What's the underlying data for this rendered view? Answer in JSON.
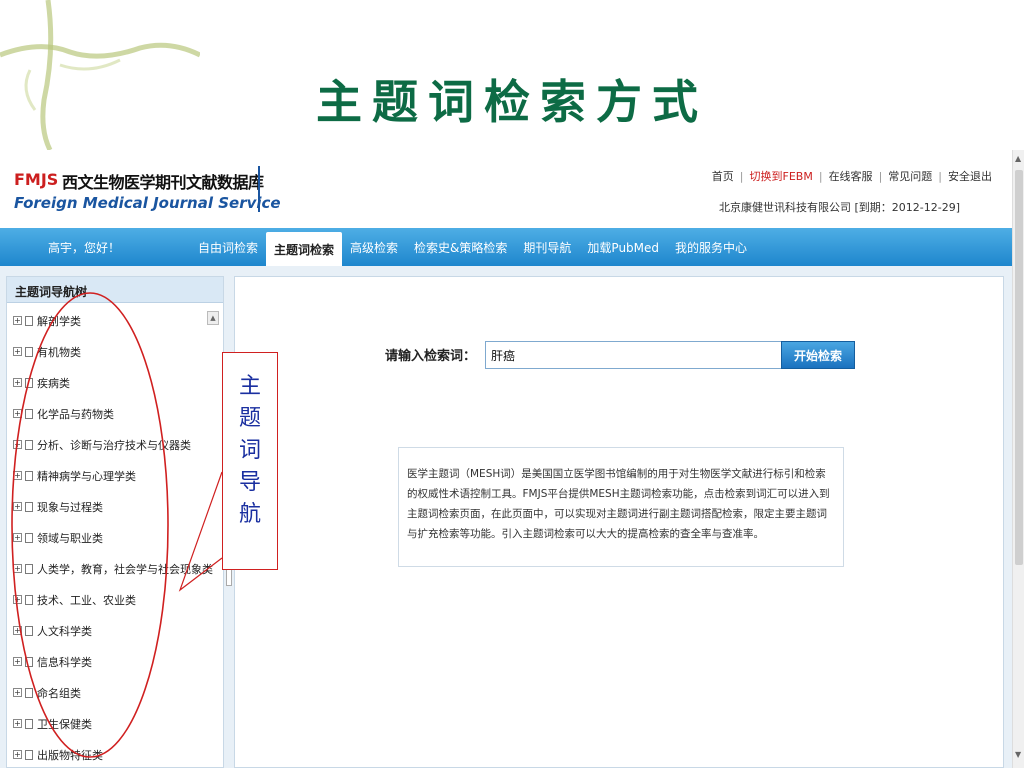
{
  "slide": {
    "title": "主题词检索方式"
  },
  "header": {
    "logo_abbr": "FMJS",
    "logo_cn": "西文生物医学期刊文献数据库",
    "logo_en": "Foreign Medical Journal Service",
    "top_links": [
      {
        "label": "首页",
        "color": "#333333"
      },
      {
        "label": "切换到FEBM",
        "color": "#cc1f1f"
      },
      {
        "label": "在线客服",
        "color": "#333333"
      },
      {
        "label": "常见问题",
        "color": "#333333"
      },
      {
        "label": "安全退出",
        "color": "#333333"
      }
    ],
    "company": "北京康健世讯科技有限公司 [到期：2012-12-29]"
  },
  "nav": {
    "greeting": "高宇，您好！",
    "items": [
      {
        "label": "自由词检索",
        "active": false
      },
      {
        "label": "主题词检索",
        "active": true
      },
      {
        "label": "高级检索",
        "active": false
      },
      {
        "label": "检索史&策略检索",
        "active": false
      },
      {
        "label": "期刊导航",
        "active": false
      },
      {
        "label": "加载PubMed",
        "active": false
      },
      {
        "label": "我的服务中心",
        "active": false
      }
    ]
  },
  "sidebar": {
    "title": "主题词导航树",
    "items": [
      "解剖学类",
      "有机物类",
      "疾病类",
      "化学品与药物类",
      "分析、诊断与治疗技术与仪器类",
      "精神病学与心理学类",
      "现象与过程类",
      "领域与职业类",
      "人类学，教育，社会学与社会现象类",
      "技术、工业、农业类",
      "人文科学类",
      "信息科学类",
      "命名组类",
      "卫生保健类",
      "出版物特征类"
    ]
  },
  "search": {
    "label": "请输入检索词：",
    "value": "肝癌",
    "button": "开始检索"
  },
  "info": {
    "text": "医学主题词（MESH词）是美国国立医学图书馆编制的用于对生物医学文献进行标引和检索的权威性术语控制工具。FMJS平台提供MESH主题词检索功能，点击检索到词汇可以进入到主题词检索页面，在此页面中，可以实现对主题词进行副主题词搭配检索，限定主要主题词与扩充检索等功能。引入主题词检索可以大大的提高检索的查全率与查准率。"
  },
  "annotation": {
    "label": [
      "主",
      "题",
      "词",
      "导",
      "航"
    ],
    "color": "#d02020",
    "text_color": "#1a2fa0"
  },
  "theme": {
    "title_color": "#0d6b45",
    "nav_color": "#1e86cd"
  }
}
